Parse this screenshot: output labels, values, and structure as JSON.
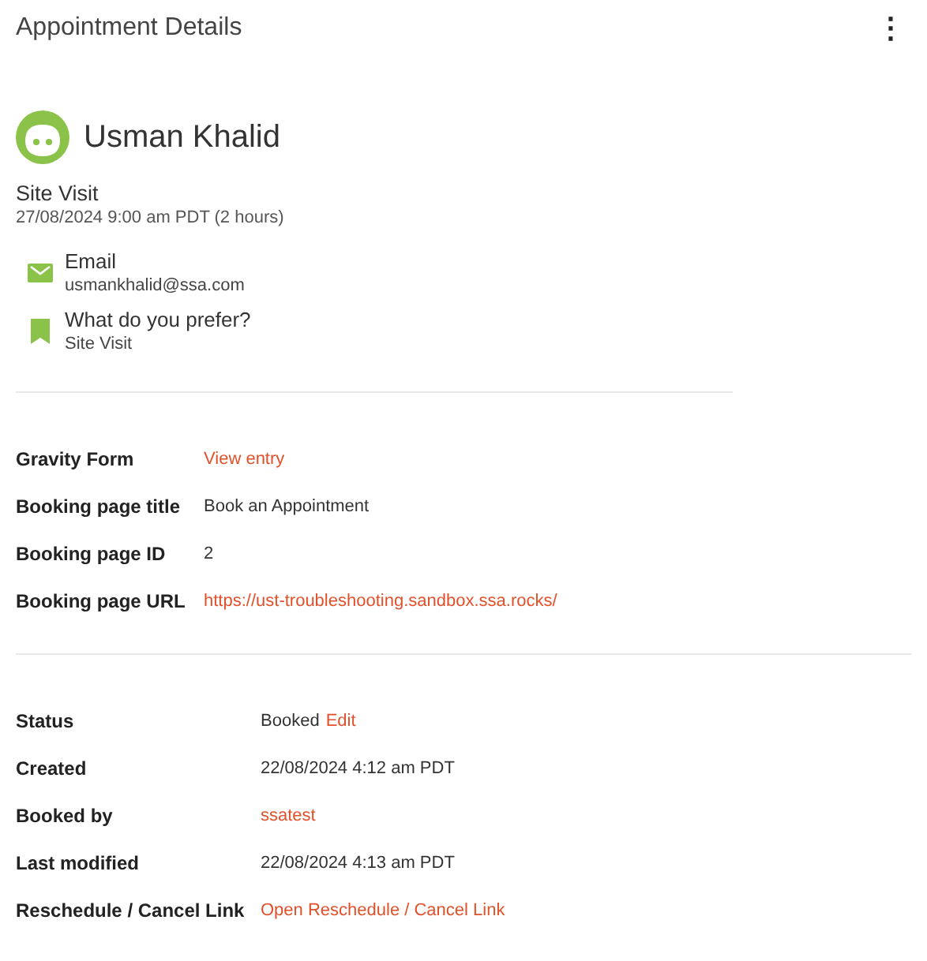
{
  "header": {
    "title": "Appointment Details",
    "menu": "⋮"
  },
  "customer": {
    "name": "Usman Khalid"
  },
  "appointment": {
    "type": "Site Visit",
    "datetime": "27/08/2024 9:00 am PDT (2 hours)"
  },
  "fields": [
    {
      "kind": "email",
      "label": "Email",
      "value": "usmankhalid@ssa.com"
    },
    {
      "kind": "bookmark",
      "label": "What do you prefer?",
      "value": "Site Visit"
    }
  ],
  "booking_details": [
    {
      "label": "Gravity Form",
      "kind": "link",
      "value": "View entry"
    },
    {
      "label": "Booking page title",
      "kind": "text",
      "value": "Book an Appointment"
    },
    {
      "label": "Booking page ID",
      "kind": "text",
      "value": "2"
    },
    {
      "label": "Booking page URL",
      "kind": "link",
      "value": "https://ust-troubleshooting.sandbox.ssa.rocks/"
    }
  ],
  "meta": [
    {
      "label": "Status",
      "kind": "text_link",
      "value": "Booked",
      "link": "Edit"
    },
    {
      "label": "Created",
      "kind": "text",
      "value": "22/08/2024 4:12 am PDT"
    },
    {
      "label": "Booked by",
      "kind": "link",
      "value": "ssatest"
    },
    {
      "label": "Last modified",
      "kind": "text",
      "value": "22/08/2024 4:13 am PDT"
    },
    {
      "label": "Reschedule / Cancel Link",
      "kind": "link",
      "value": "Open Reschedule / Cancel Link"
    }
  ]
}
